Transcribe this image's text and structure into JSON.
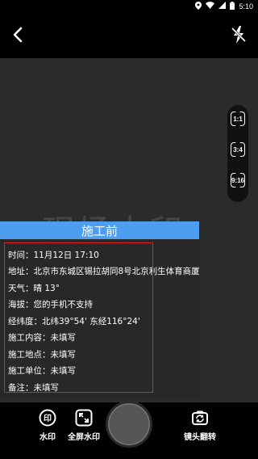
{
  "status_bar": {
    "time": "5:10",
    "icons": [
      "location-icon",
      "wifi-icon",
      "signal-icon",
      "battery-icon"
    ]
  },
  "top_bar": {
    "back_icon": "chevron-left-icon",
    "flash_icon": "flash-off-icon"
  },
  "ratio_options": [
    "1:1",
    "3:4",
    "9:16"
  ],
  "watermark": {
    "background_text": "现场水印",
    "title": "施工前",
    "header_color": "#4e9ef0",
    "rows": [
      "时间：11月12日 17:10",
      "地址：北京市东城区锡拉胡同8号北京利生体育商厦",
      "天气：晴 13°",
      "海拔：您的手机不支持",
      "经纬度：北纬39°54' 东经116°24'",
      "施工内容：未填写",
      "施工地点：未填写",
      "施工单位：未填写",
      "备注：未填写"
    ]
  },
  "selection_box_color": "#e02020",
  "bottom_bar": {
    "watermark_label": "水印",
    "fullscreen_label": "全屏水印",
    "flip_label": "镜头翻转"
  }
}
